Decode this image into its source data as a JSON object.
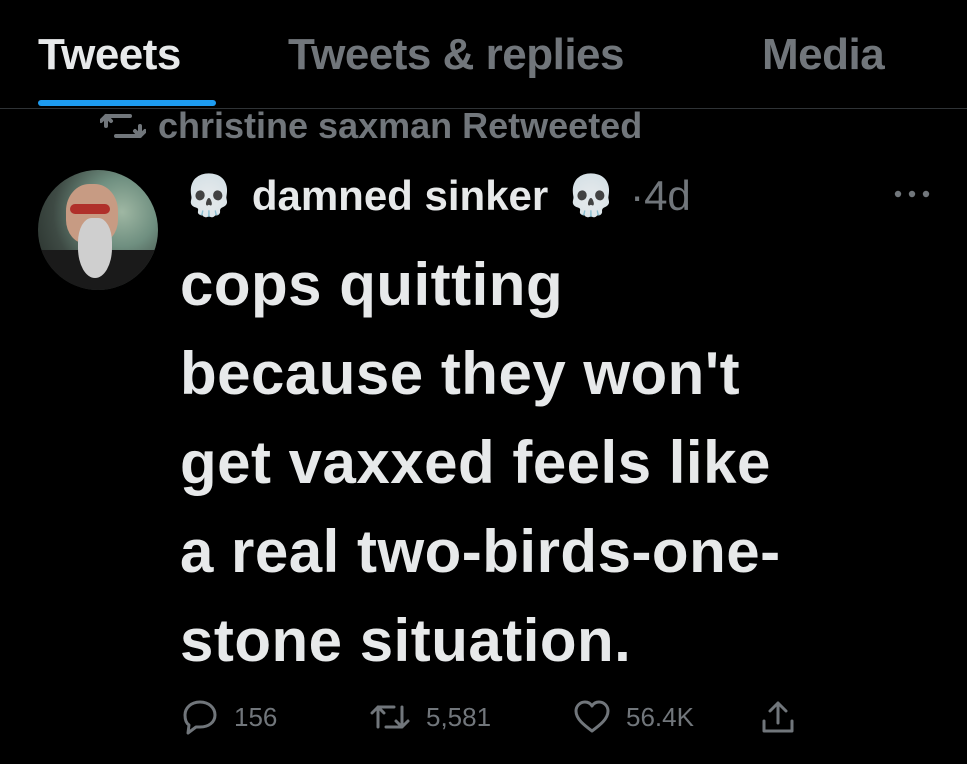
{
  "tabs": [
    {
      "label": "Tweets",
      "active": true
    },
    {
      "label": "Tweets & replies",
      "active": false
    },
    {
      "label": "Media",
      "active": false
    }
  ],
  "accent_color": "#1d9bf0",
  "social_context": {
    "icon": "retweet-icon",
    "text": "christine saxman Retweeted"
  },
  "tweet": {
    "author": {
      "display_name": "damned sinker",
      "emoji_left": "💀",
      "emoji_right": "💀",
      "avatar": "avatar"
    },
    "time": "·4d",
    "text": "cops quitting\nbecause they won't\nget vaxxed feels like\na real two-birds-one-\nstone situation.",
    "stats": {
      "replies": "156",
      "retweets": "5,581",
      "likes": "56.4K"
    },
    "icons": {
      "reply": "reply-icon",
      "retweet": "retweet-icon",
      "like": "heart-icon",
      "share": "share-icon",
      "more": "more-icon"
    }
  }
}
